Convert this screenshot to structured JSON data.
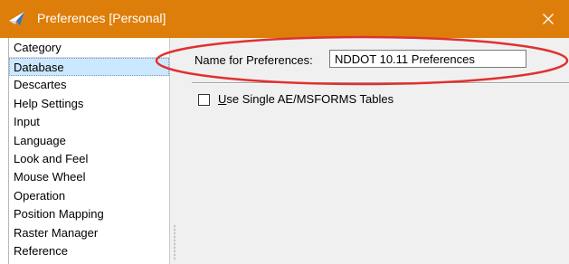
{
  "window": {
    "title": "Preferences [Personal]",
    "close_icon": "close-icon",
    "app_icon": "microstation-icon",
    "titlebar_color": "#dd7e0a"
  },
  "category": {
    "header": "Category",
    "selected_index": 0,
    "items": [
      {
        "label": "Database"
      },
      {
        "label": "Descartes"
      },
      {
        "label": "Help Settings"
      },
      {
        "label": "Input"
      },
      {
        "label": "Language"
      },
      {
        "label": "Look and Feel"
      },
      {
        "label": "Mouse Wheel"
      },
      {
        "label": "Operation"
      },
      {
        "label": "Position Mapping"
      },
      {
        "label": "Raster Manager"
      },
      {
        "label": "Reference"
      }
    ]
  },
  "content": {
    "name_label": "Name for Preferences:",
    "name_value": "NDDOT 10.11 Preferences",
    "checkbox": {
      "mnemonic": "U",
      "label_rest": "se Single AE/MSFORMS Tables",
      "checked": false
    }
  },
  "annotation": {
    "color": "#e0312f",
    "shape": "ellipse",
    "target": "name-for-preferences-field"
  }
}
